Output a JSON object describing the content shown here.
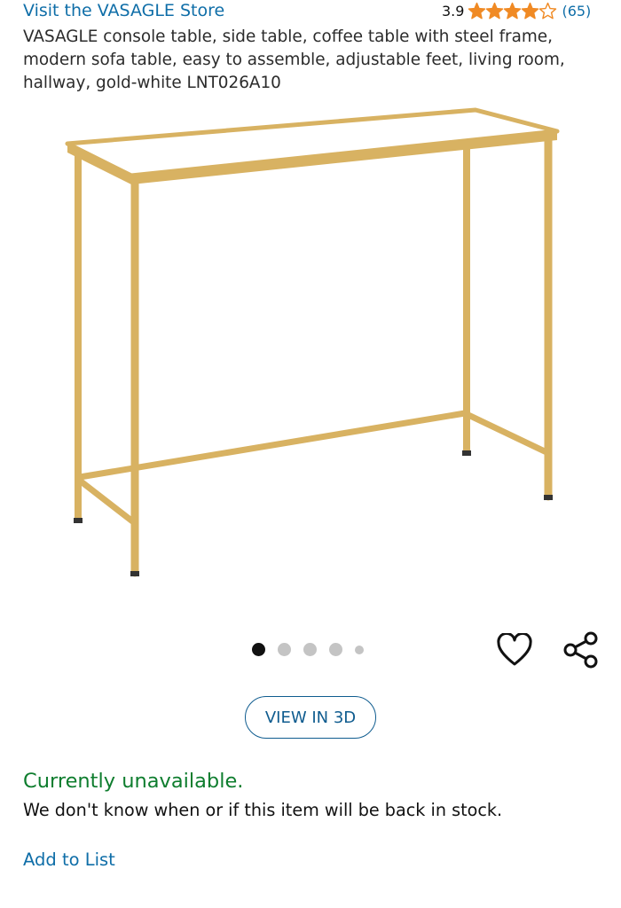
{
  "store": {
    "link_label": "Visit the VASAGLE Store"
  },
  "rating": {
    "value": "3.9",
    "stars": 3.9,
    "star_count": 5,
    "count_label": "(65)",
    "star_color": "#f08a24"
  },
  "product": {
    "title": "VASAGLE console table, side table, coffee table with steel frame, modern sofa table, easy to assemble, adjustable feet, living room, hallway, gold-white LNT026A10",
    "image_icon": "console-table-image",
    "frame_color": "#d8b262",
    "top_color": "#ffffff"
  },
  "gallery": {
    "image_count": 5,
    "active_index": 0
  },
  "actions": {
    "wishlist_icon": "heart-icon",
    "share_icon": "share-icon",
    "view3d_label": "VIEW IN 3D",
    "add_to_list_label": "Add to List"
  },
  "availability": {
    "status": "Currently unavailable.",
    "note": "We don't know when or if this item will be back in stock.",
    "status_color": "#0e7d2e"
  }
}
